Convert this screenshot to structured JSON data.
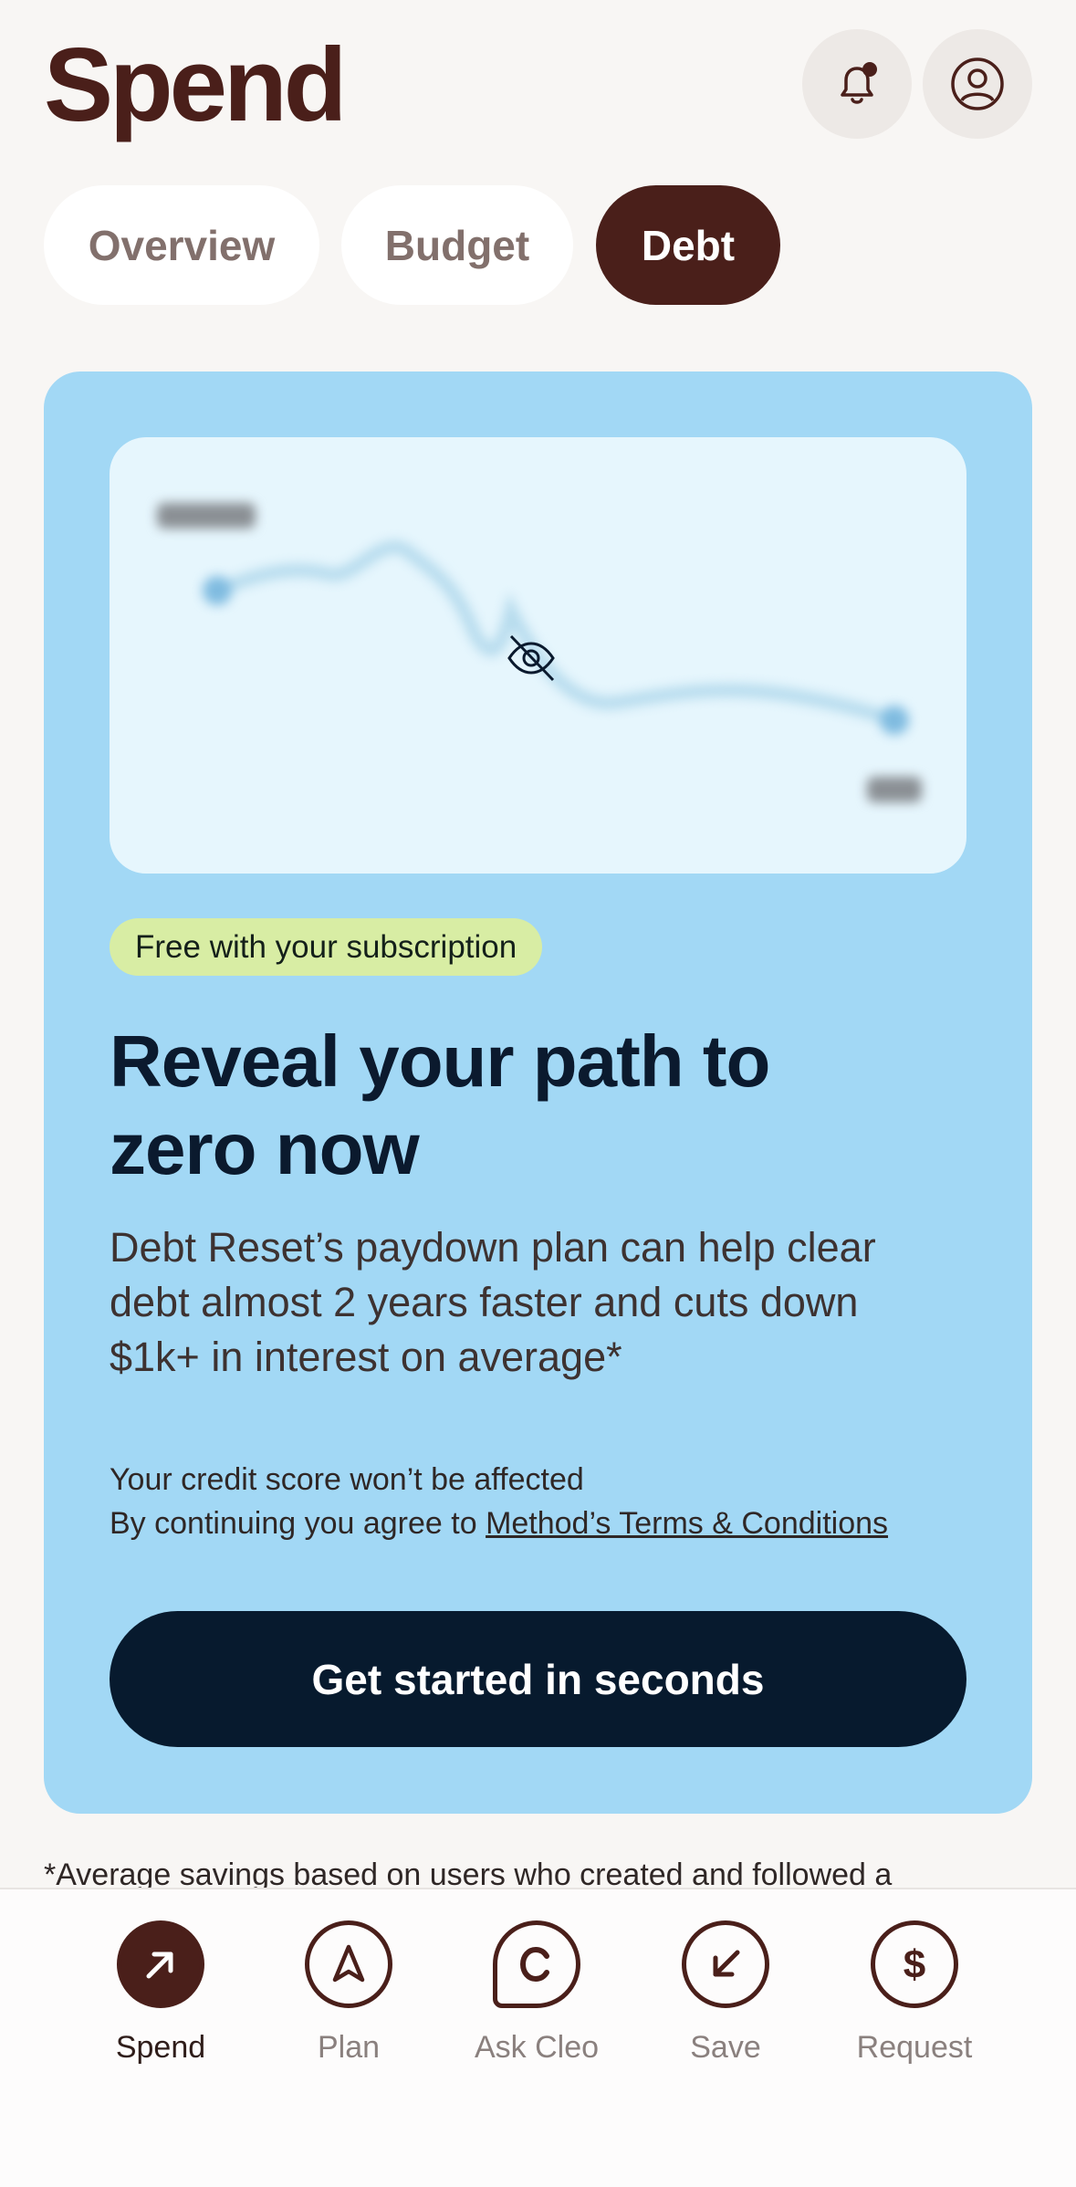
{
  "header": {
    "title": "Spend",
    "notification_icon": "bell-with-dot-icon",
    "profile_icon": "user-circle-icon"
  },
  "tabs": [
    {
      "label": "Overview",
      "active": false
    },
    {
      "label": "Budget",
      "active": false
    },
    {
      "label": "Debt",
      "active": true
    }
  ],
  "promo_card": {
    "chart_preview": {
      "hidden": true,
      "icon": "eye-off-icon"
    },
    "badge": "Free with your subscription",
    "headline": "Reveal your path to zero now",
    "body": "Debt Reset’s paydown plan can help clear debt almost 2 years faster and cuts down $1k+ in interest on average*",
    "fine_print_line1": "Your credit score won’t be affected",
    "fine_print_prefix": "By continuing you agree to ",
    "terms_link": "Method’s Terms & Conditions",
    "cta_label": "Get started in seconds"
  },
  "footnote": "*Average savings based on users who created and followed a",
  "bottom_nav": [
    {
      "label": "Spend",
      "icon": "arrow-up-right-icon",
      "active": true
    },
    {
      "label": "Plan",
      "icon": "navigation-arrow-icon",
      "active": false
    },
    {
      "label": "Ask Cleo",
      "icon": "chat-c-icon",
      "active": false
    },
    {
      "label": "Save",
      "icon": "arrow-down-left-icon",
      "active": false
    },
    {
      "label": "Request",
      "icon": "dollar-icon",
      "active": false
    }
  ],
  "colors": {
    "brand_dark": "#4a1f1a",
    "card_bg": "#a2d8f5",
    "cta_bg": "#071a2e",
    "badge_bg": "#d8eda4"
  }
}
